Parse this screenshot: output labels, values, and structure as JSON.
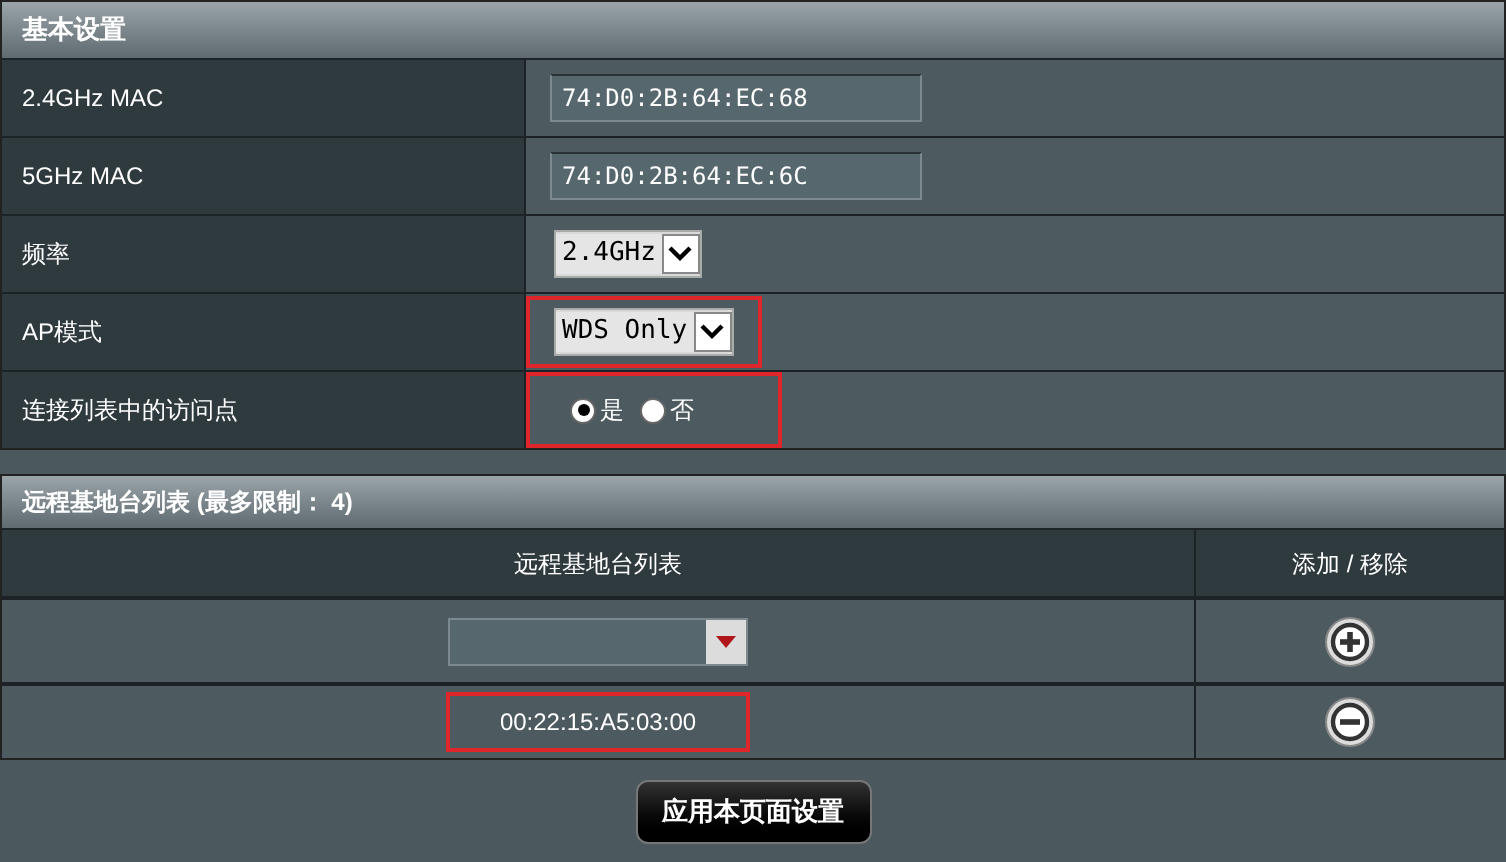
{
  "basic_settings": {
    "title": "基本设置",
    "rows": [
      {
        "label": "2.4GHz MAC",
        "kind": "text",
        "value": "74:D0:2B:64:EC:68",
        "highlighted": false
      },
      {
        "label": "5GHz MAC",
        "kind": "text",
        "value": "74:D0:2B:64:EC:6C",
        "highlighted": false
      },
      {
        "label": "频率",
        "kind": "select",
        "value": "2.4GHz",
        "highlighted": false
      },
      {
        "label": "AP模式",
        "kind": "select",
        "value": "WDS Only",
        "highlighted": true
      },
      {
        "label": "连接列表中的访问点",
        "kind": "radio",
        "options": [
          {
            "label": "是",
            "selected": true
          },
          {
            "label": "否",
            "selected": false
          }
        ],
        "highlighted": true
      }
    ]
  },
  "remote_list": {
    "title": "远程基地台列表 (最多限制： 4)",
    "columns": [
      "远程基地台列表",
      "添加 / 移除"
    ],
    "rows": [
      {
        "kind": "add",
        "highlighted": false
      },
      {
        "kind": "entry",
        "value": "00:22:15:A5:03:00",
        "highlighted": true
      }
    ]
  },
  "apply_button": "应用本页面设置"
}
